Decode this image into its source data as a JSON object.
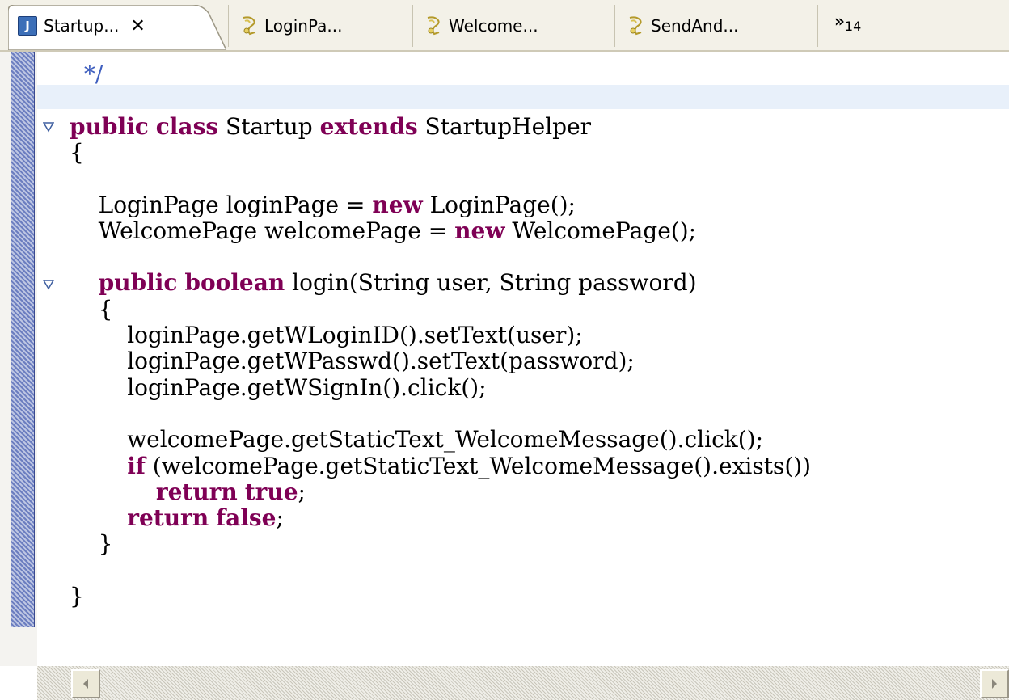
{
  "tabs": [
    {
      "label": "Startup...",
      "icon": "java-file-icon",
      "active": true,
      "close": "✕"
    },
    {
      "label": "LoginPa...",
      "icon": "script-icon"
    },
    {
      "label": "Welcome...",
      "icon": "script-icon"
    },
    {
      "label": "SendAnd...",
      "icon": "script-icon"
    }
  ],
  "overflow": {
    "chevron": "»",
    "count": "14"
  },
  "code_lines": [
    [
      {
        "t": "  "
      },
      {
        "t": "*/",
        "c": "comment"
      }
    ],
    [
      {
        "t": ""
      }
    ],
    [
      {
        "t": "public",
        "c": "kw"
      },
      {
        "t": " "
      },
      {
        "t": "class",
        "c": "kw"
      },
      {
        "t": " Startup "
      },
      {
        "t": "extends",
        "c": "kw"
      },
      {
        "t": " StartupHelper"
      }
    ],
    [
      {
        "t": "{"
      }
    ],
    [
      {
        "t": ""
      }
    ],
    [
      {
        "t": "    LoginPage loginPage = "
      },
      {
        "t": "new",
        "c": "kw"
      },
      {
        "t": " LoginPage();"
      }
    ],
    [
      {
        "t": "    WelcomePage welcomePage = "
      },
      {
        "t": "new",
        "c": "kw"
      },
      {
        "t": " WelcomePage();"
      }
    ],
    [
      {
        "t": ""
      }
    ],
    [
      {
        "t": "    "
      },
      {
        "t": "public",
        "c": "kw"
      },
      {
        "t": " "
      },
      {
        "t": "boolean",
        "c": "kw"
      },
      {
        "t": " login(String user, String password)"
      }
    ],
    [
      {
        "t": "    {"
      }
    ],
    [
      {
        "t": "        loginPage.getWLoginID().setText(user);"
      }
    ],
    [
      {
        "t": "        loginPage.getWPasswd().setText(password);"
      }
    ],
    [
      {
        "t": "        loginPage.getWSignIn().click();"
      }
    ],
    [
      {
        "t": ""
      }
    ],
    [
      {
        "t": "        welcomePage.getStaticText_WelcomeMessage().click();"
      }
    ],
    [
      {
        "t": "        "
      },
      {
        "t": "if",
        "c": "kw"
      },
      {
        "t": " (welcomePage.getStaticText_WelcomeMessage().exists())"
      }
    ],
    [
      {
        "t": "            "
      },
      {
        "t": "return",
        "c": "kw"
      },
      {
        "t": " "
      },
      {
        "t": "true",
        "c": "kw"
      },
      {
        "t": ";"
      }
    ],
    [
      {
        "t": "        "
      },
      {
        "t": "return",
        "c": "kw"
      },
      {
        "t": " "
      },
      {
        "t": "false",
        "c": "kw"
      },
      {
        "t": ";"
      }
    ],
    [
      {
        "t": "    }"
      }
    ],
    [
      {
        "t": ""
      }
    ],
    [
      {
        "t": "}"
      }
    ]
  ],
  "colors": {
    "keyword": "#7f0055",
    "comment": "#3f5fbf",
    "current_line": "#e8f0fa"
  }
}
